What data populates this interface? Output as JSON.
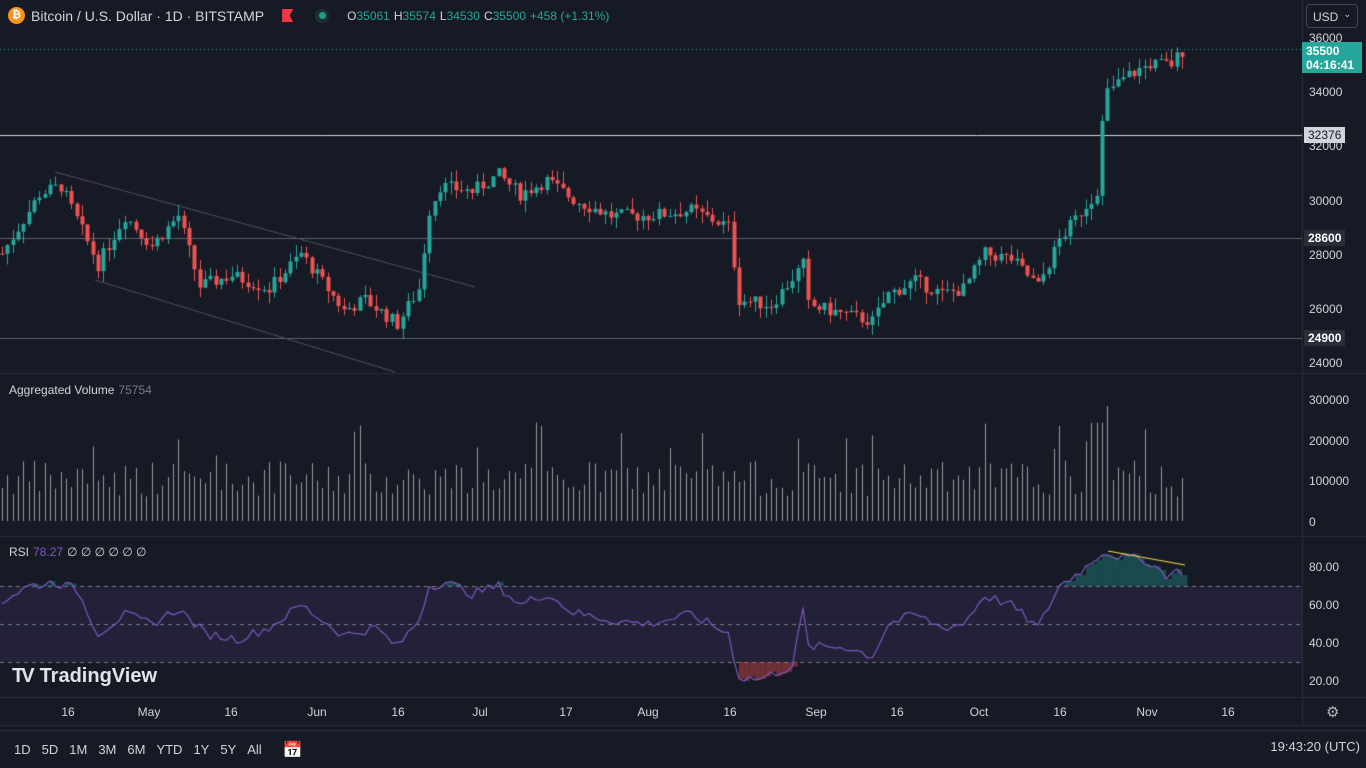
{
  "header": {
    "symbol": "Bitcoin / U.S. Dollar · 1D · BITSTAMP",
    "coin_glyph": "₿",
    "open_label": "O",
    "open": "35061",
    "high_label": "H",
    "high": "35574",
    "low_label": "L",
    "low": "34530",
    "close_label": "C",
    "close": "35500",
    "change": "+458 (+1.31%)"
  },
  "currency": {
    "label": "USD",
    "chevron": "⌄"
  },
  "price_tag": {
    "price": "35500",
    "countdown": "04:16:41"
  },
  "levels": [
    "32376",
    "28600",
    "24900"
  ],
  "price_axis": [
    "36000",
    "34000",
    "32000",
    "30000",
    "28000",
    "26000",
    "24000"
  ],
  "volume": {
    "title": "Aggregated Volume",
    "value": "75754",
    "axis": [
      "300000",
      "200000",
      "100000",
      "0"
    ]
  },
  "rsi": {
    "title": "RSI",
    "value": "78.27",
    "nulls": "∅ ∅ ∅ ∅ ∅ ∅",
    "axis": [
      "80.00",
      "60.00",
      "40.00",
      "20.00"
    ]
  },
  "time_axis": [
    "16",
    "May",
    "16",
    "Jun",
    "16",
    "Jul",
    "17",
    "Aug",
    "16",
    "Sep",
    "16",
    "Oct",
    "16",
    "Nov",
    "16"
  ],
  "brand": "TradingView",
  "bottom": {
    "ranges": [
      "1D",
      "5D",
      "1M",
      "3M",
      "6M",
      "YTD",
      "1Y",
      "5Y",
      "All"
    ],
    "clock": "19:43:20 (UTC)"
  },
  "colors": {
    "up": "#26a69a",
    "down": "#ef5350",
    "rsi": "#7e57c2",
    "bg": "#161a25"
  },
  "chart_data": {
    "type": "candlestick",
    "price_range": [
      24000,
      36000
    ],
    "close_keypoints": [
      [
        0,
        28000
      ],
      [
        7,
        30200
      ],
      [
        11,
        30500
      ],
      [
        18,
        27600
      ],
      [
        23,
        29400
      ],
      [
        28,
        28300
      ],
      [
        33,
        29400
      ],
      [
        37,
        26800
      ],
      [
        43,
        27200
      ],
      [
        50,
        26700
      ],
      [
        56,
        28000
      ],
      [
        64,
        25900
      ],
      [
        68,
        26300
      ],
      [
        74,
        25400
      ],
      [
        78,
        26700
      ],
      [
        80,
        29600
      ],
      [
        82,
        30500
      ],
      [
        88,
        30300
      ],
      [
        93,
        30900
      ],
      [
        97,
        30200
      ],
      [
        102,
        30700
      ],
      [
        107,
        30000
      ],
      [
        114,
        29400
      ],
      [
        121,
        29400
      ],
      [
        129,
        29600
      ],
      [
        136,
        29000
      ],
      [
        138,
        26300
      ],
      [
        144,
        26100
      ],
      [
        150,
        27600
      ],
      [
        151,
        26100
      ],
      [
        163,
        25500
      ],
      [
        166,
        26500
      ],
      [
        171,
        27000
      ],
      [
        176,
        26500
      ],
      [
        180,
        26700
      ],
      [
        184,
        28000
      ],
      [
        189,
        27800
      ],
      [
        194,
        26800
      ],
      [
        198,
        28500
      ],
      [
        203,
        29800
      ],
      [
        205,
        30200
      ],
      [
        206,
        33100
      ],
      [
        207,
        34000
      ],
      [
        211,
        34600
      ],
      [
        215,
        35000
      ],
      [
        219,
        35000
      ],
      [
        221,
        35500
      ]
    ],
    "rsi_keypoints": [
      [
        0,
        62
      ],
      [
        5,
        70
      ],
      [
        10,
        72
      ],
      [
        14,
        68
      ],
      [
        18,
        45
      ],
      [
        23,
        55
      ],
      [
        28,
        50
      ],
      [
        33,
        58
      ],
      [
        38,
        45
      ],
      [
        44,
        42
      ],
      [
        50,
        48
      ],
      [
        56,
        60
      ],
      [
        64,
        44
      ],
      [
        70,
        48
      ],
      [
        74,
        38
      ],
      [
        78,
        52
      ],
      [
        80,
        70
      ],
      [
        83,
        72
      ],
      [
        88,
        66
      ],
      [
        93,
        70
      ],
      [
        97,
        60
      ],
      [
        102,
        66
      ],
      [
        107,
        56
      ],
      [
        114,
        52
      ],
      [
        121,
        50
      ],
      [
        129,
        55
      ],
      [
        136,
        45
      ],
      [
        138,
        22
      ],
      [
        142,
        21
      ],
      [
        148,
        28
      ],
      [
        150,
        57
      ],
      [
        151,
        38
      ],
      [
        158,
        38
      ],
      [
        163,
        33
      ],
      [
        166,
        50
      ],
      [
        171,
        55
      ],
      [
        176,
        48
      ],
      [
        180,
        50
      ],
      [
        184,
        65
      ],
      [
        189,
        60
      ],
      [
        194,
        48
      ],
      [
        198,
        70
      ],
      [
        203,
        80
      ],
      [
        206,
        88
      ],
      [
        210,
        85
      ],
      [
        214,
        84
      ],
      [
        218,
        76
      ],
      [
        221,
        78
      ]
    ]
  }
}
